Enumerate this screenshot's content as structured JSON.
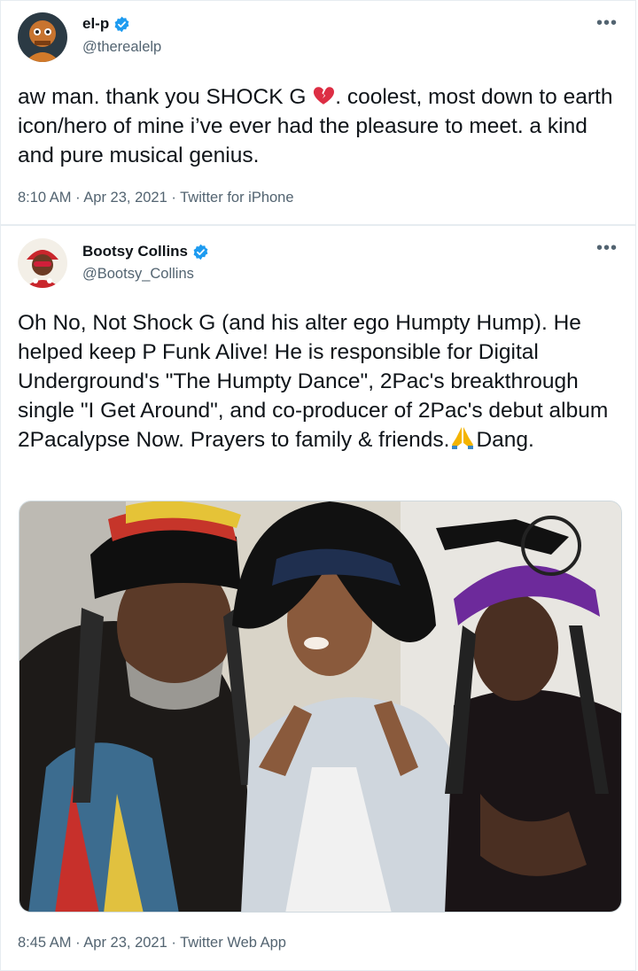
{
  "tweets": [
    {
      "name": "el-p",
      "handle": "@therealelp",
      "text_before_emoji": "aw man. thank you SHOCK G ",
      "text_after_emoji": ". coolest, most down to earth icon/hero of mine i’ve ever had the pleasure to meet. a kind and pure musical genius.",
      "emoji": "broken-heart",
      "meta": "8:10 AM · Apr 23, 2021 · Twitter for iPhone",
      "more_label": "•••"
    },
    {
      "name": "Bootsy Collins",
      "handle": "@Bootsy_Collins",
      "text_before_emoji": "Oh No, Not  Shock G (and his alter ego Humpty Hump). He helped keep P Funk Alive! He is responsible for Digital Underground's \"The Humpty Dance\", 2Pac's breakthrough single \"I Get Around\", and co-producer of 2Pac's debut album 2Pacalypse Now. Prayers to family & friends.",
      "text_after_emoji": "Dang.",
      "emoji": "folded-hands",
      "meta": "8:45 AM · Apr 23, 2021 · Twitter Web App",
      "more_label": "•••"
    }
  ],
  "colors": {
    "verified": "#1d9bf0",
    "secondary": "#536471",
    "border": "#e6ecf0"
  },
  "icons": {
    "verified": "verified-badge-icon",
    "more": "more-options-icon"
  }
}
